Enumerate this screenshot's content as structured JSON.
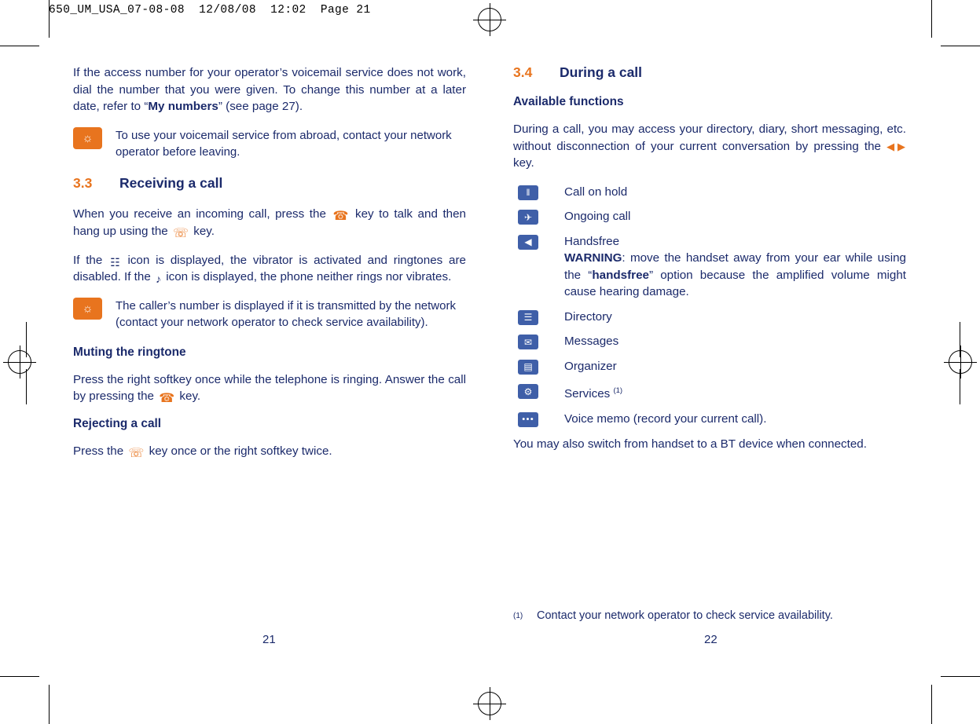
{
  "slug": "650_UM_USA_07-08-08  12/08/08  12:02  Page 21",
  "left_column": {
    "intro_para": {
      "part1": "If the access number for your operator’s voicemail service does not work, dial the number that you were given. To change this number at a later date, refer to “",
      "bold": "My numbers",
      "part2": "” (see page 27)."
    },
    "note1": "To use your voicemail service from abroad, contact your network operator before leaving.",
    "section": {
      "number": "3.3",
      "title": "Receiving a call"
    },
    "para_incoming": {
      "part1": "When you receive an incoming call, press the",
      "part2": "key to talk and then hang up using the",
      "part3": "key."
    },
    "para_vibrator": {
      "part1": "If the",
      "part2": "icon is displayed, the vibrator is activated and ringtones are disabled. If the",
      "part3": "icon is displayed, the phone neither rings nor vibrates."
    },
    "note2": "The caller’s number is displayed if it is transmitted by the network (contact your network operator to check service availability).",
    "sub_mute": "Muting the ringtone",
    "para_mute": {
      "part1": "Press the right softkey once while the telephone is ringing. Answer the call by pressing the",
      "part2": "key."
    },
    "sub_reject": "Rejecting a call",
    "para_reject": {
      "part1": "Press the",
      "part2": "key once or the right softkey twice."
    },
    "page_number": "21"
  },
  "right_column": {
    "section": {
      "number": "3.4",
      "title": "During a call"
    },
    "sub_available": "Available functions",
    "para_during": {
      "part1": "During a call, you may access your directory, diary, short messaging, etc. without disconnection of your current conversation by pressing the",
      "part2": "key."
    },
    "functions": [
      {
        "icon": "call-on-hold-icon",
        "glyph": "‖",
        "label": "Call on hold",
        "footnote": ""
      },
      {
        "icon": "ongoing-call-icon",
        "glyph": "✈",
        "label": "Ongoing call",
        "footnote": ""
      },
      {
        "icon": "handsfree-icon",
        "glyph": "◀",
        "label": "Handsfree",
        "footnote": ""
      },
      {
        "icon": "directory-icon",
        "glyph": "☰",
        "label": "Directory",
        "footnote": ""
      },
      {
        "icon": "messages-icon",
        "glyph": "✉",
        "label": "Messages",
        "footnote": ""
      },
      {
        "icon": "organizer-icon",
        "glyph": "▤",
        "label": "Organizer",
        "footnote": ""
      },
      {
        "icon": "services-icon",
        "glyph": "⚙",
        "label": "Services",
        "footnote": "(1)"
      },
      {
        "icon": "voice-memo-icon",
        "glyph": "●●●",
        "label": "Voice memo (record your current call).",
        "footnote": ""
      }
    ],
    "warning": {
      "label": "WARNING",
      "part1": ": move the handset away from your ear while using the “",
      "bold": "handsfree",
      "part2": "” option because the amplified volume might cause hearing damage."
    },
    "para_switch": "You may also switch from handset to a BT device when connected.",
    "footnote": {
      "mark": "(1)",
      "text": "Contact your network operator to check service availability."
    },
    "page_number": "22"
  },
  "colors": {
    "text": "#1b2a6b",
    "accent_orange": "#e8741e",
    "icon_blue": "#3f5fa8"
  }
}
